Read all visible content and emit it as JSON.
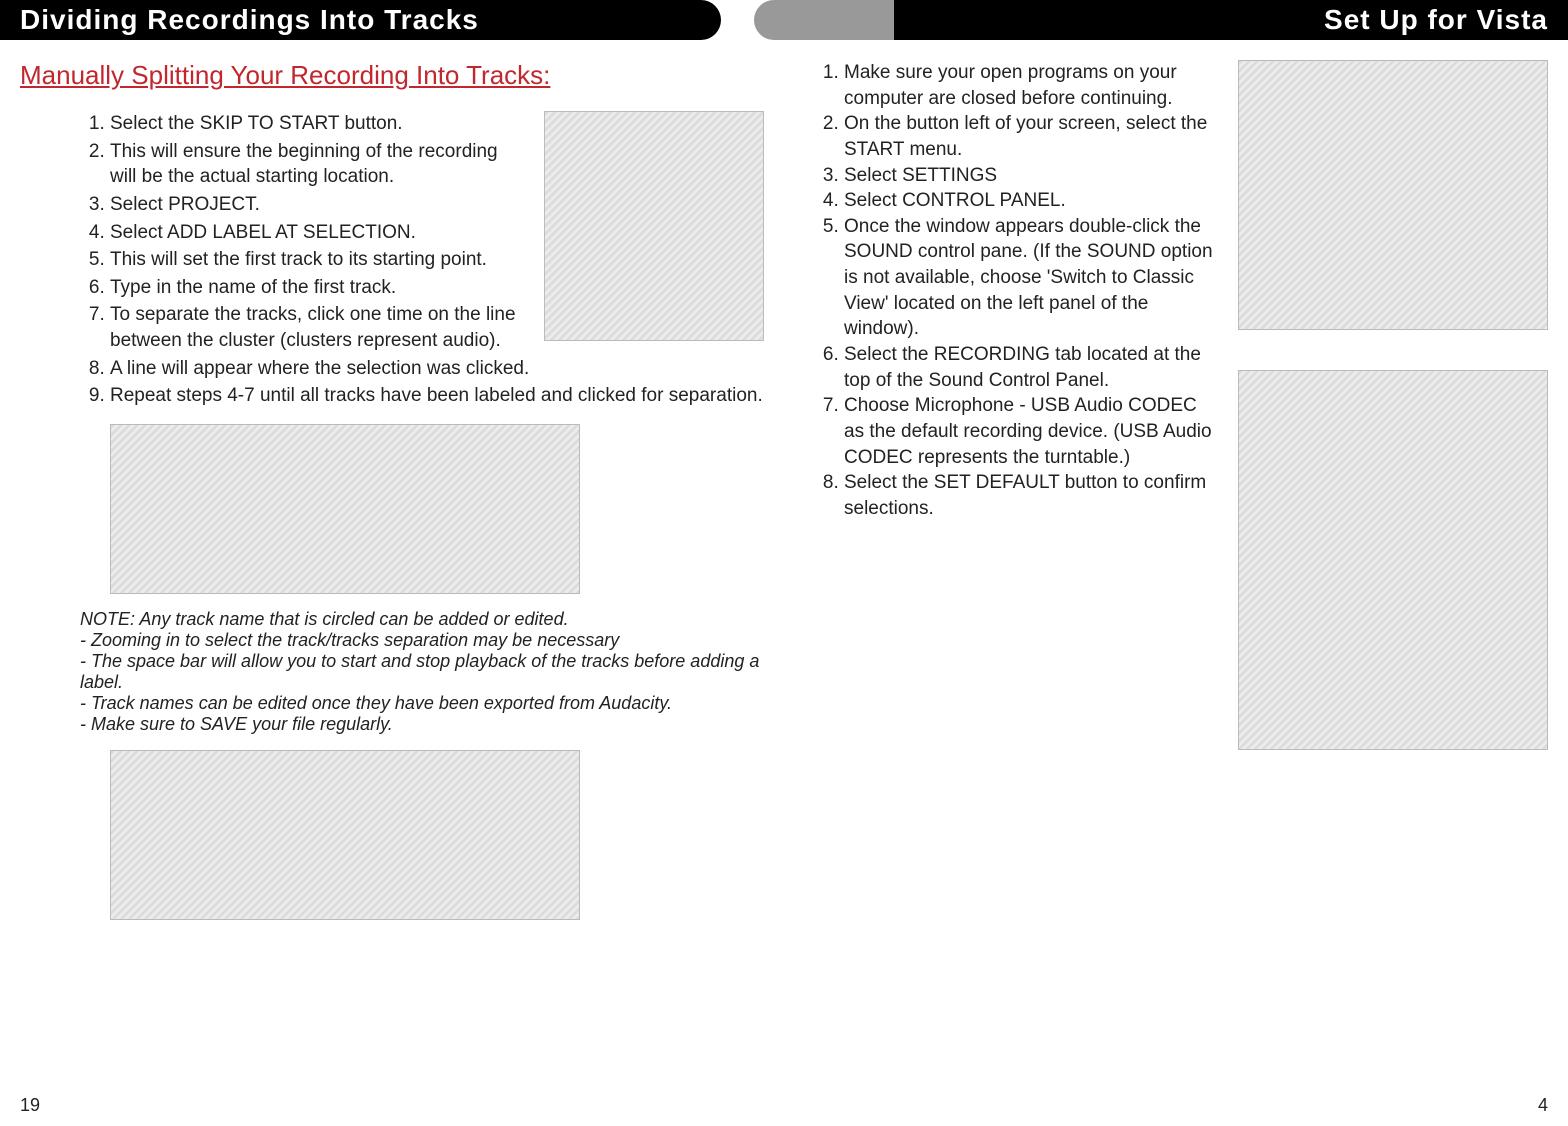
{
  "header": {
    "left": "Dividing Recordings Into Tracks",
    "right": "Set Up for Vista"
  },
  "left": {
    "title": "Manually Splitting Your Recording Into Tracks:",
    "steps": [
      "Select the SKIP TO START button.",
      "This will ensure the beginning of the recording will be the actual starting location.",
      "Select PROJECT.",
      "Select ADD LABEL AT SELECTION.",
      "This will set the first track to its starting point.",
      "Type in the name of the first track.",
      "To separate the tracks, click one time on the line between the cluster (clusters represent audio).",
      "A line will appear where the selection was clicked.",
      "Repeat steps 4-7 until all tracks have been labeled and clicked for separation."
    ],
    "notes": [
      "NOTE: Any track name that is circled can be added or edited.",
      "- Zooming in to select the track/tracks separation may be necessary",
      "- The space bar will allow you to start and stop playback of the tracks before adding a label.",
      "- Track names can be edited once they have been exported from Audacity.",
      "- Make sure to SAVE your file regularly."
    ],
    "page_num": "19"
  },
  "right": {
    "steps": [
      "Make sure your open programs on your computer are closed before continuing.",
      "On the button left of your screen, select the START menu.",
      "Select SETTINGS",
      "Select CONTROL PANEL.",
      "Once the window appears double-click the SOUND control pane. (If the SOUND option is not available, choose 'Switch to Classic View' located on the left panel of the window).",
      "Select the RECORDING tab located at the top of the Sound Control Panel.",
      "Choose Microphone - USB Audio CODEC as the default recording device. (USB Audio CODEC represents the turntable.)",
      "Select the SET DEFAULT button to confirm selections."
    ],
    "page_num": "4"
  }
}
